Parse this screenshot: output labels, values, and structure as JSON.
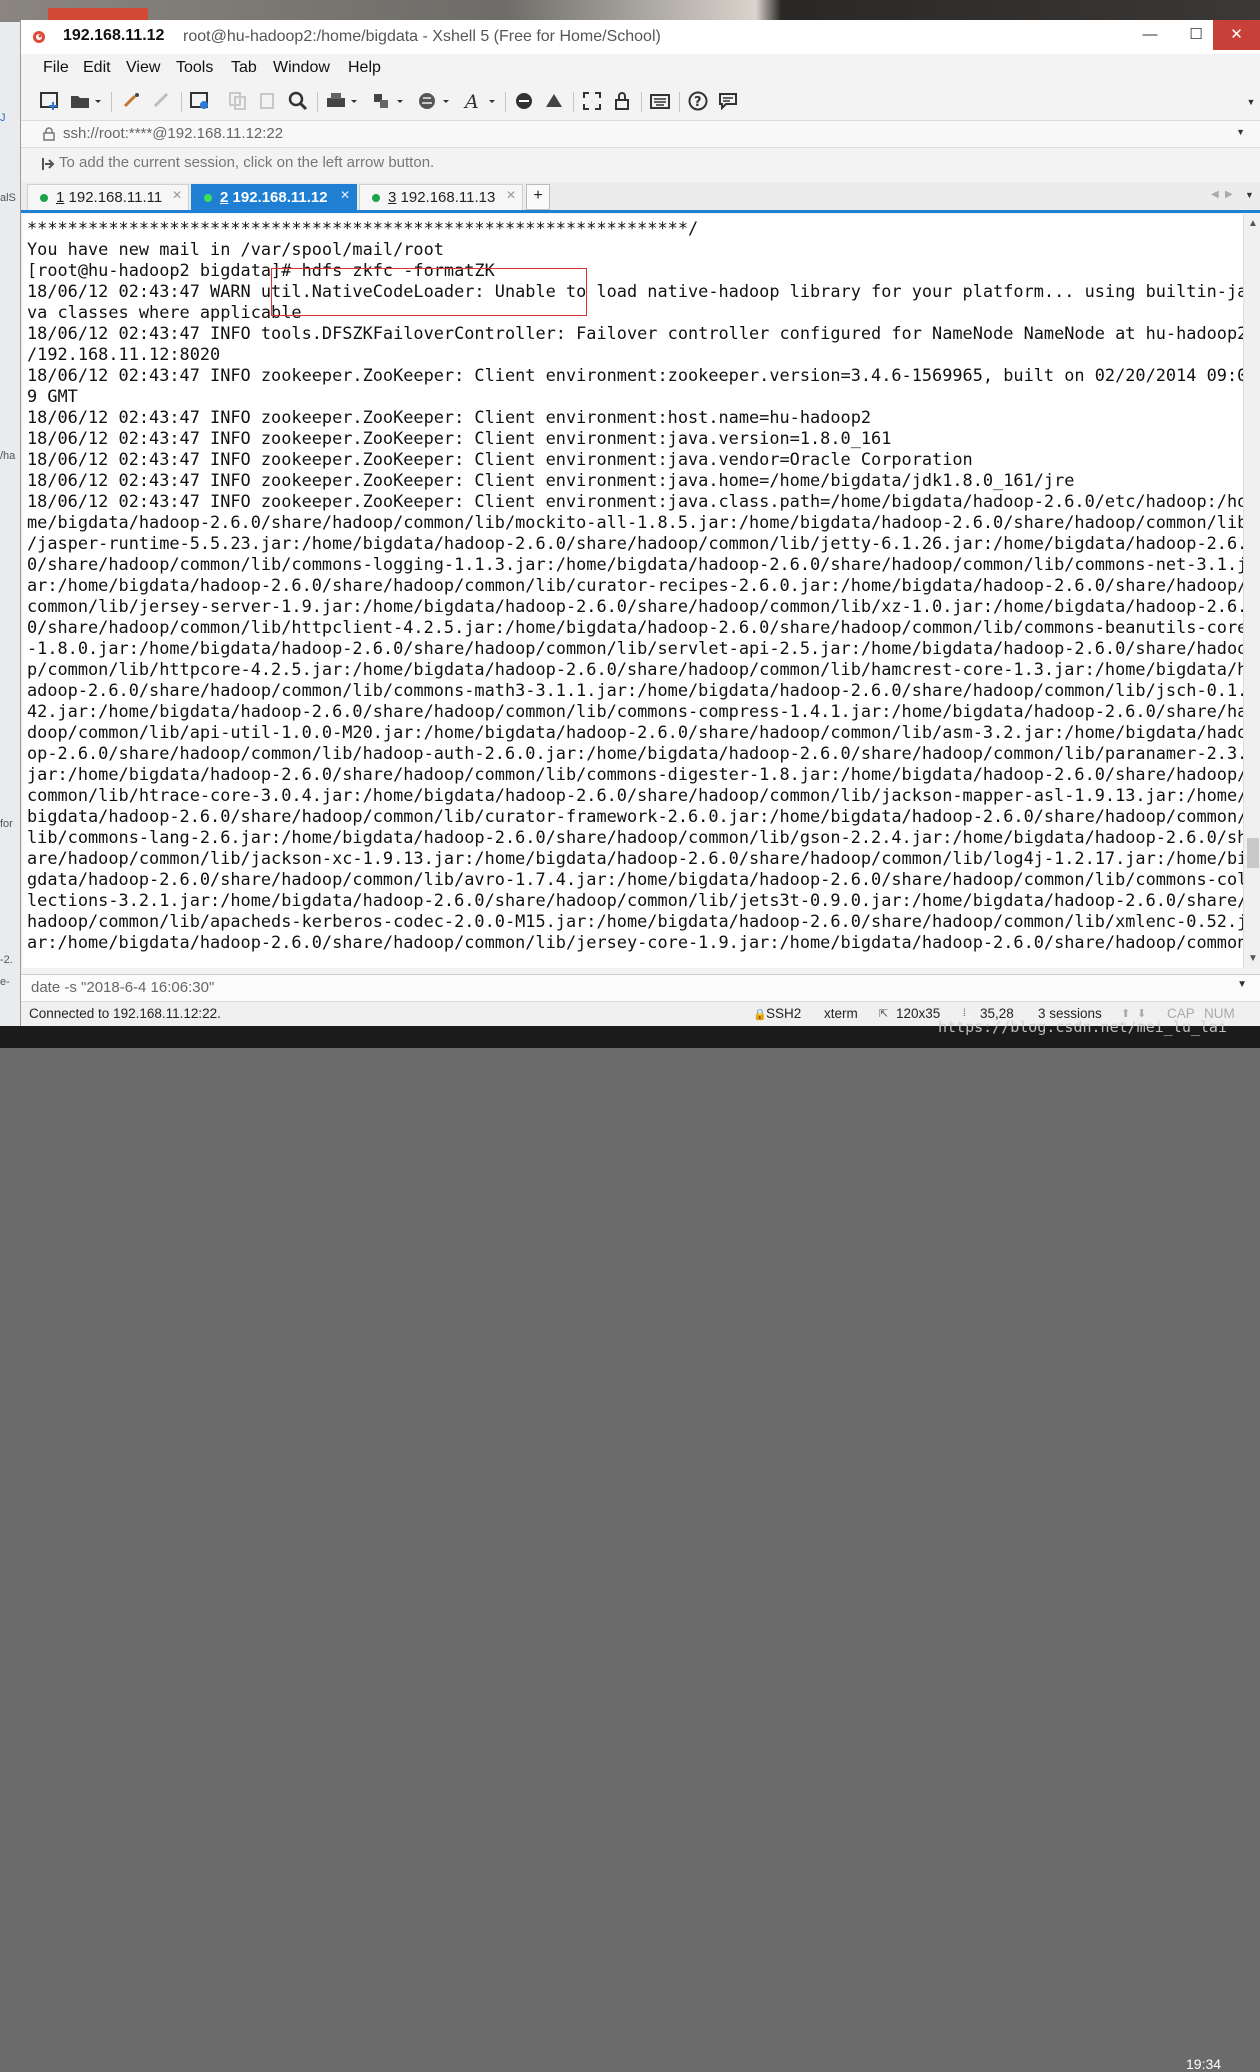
{
  "window": {
    "title_ip": "192.168.11.12",
    "title_rest": "root@hu-hadoop2:/home/bigdata - Xshell 5 (Free for Home/School)",
    "controls": {
      "minimize": "—",
      "maximize": "☐",
      "close": "✕"
    }
  },
  "menu": [
    "File",
    "Edit",
    "View",
    "Tools",
    "Tab",
    "Window",
    "Help"
  ],
  "address": {
    "text": "ssh://root:****@192.168.11.12:22"
  },
  "hint": {
    "text": "To add the current session, click on the left arrow button."
  },
  "tabs": [
    {
      "num": "1",
      "label": " 192.168.11.11",
      "active": false
    },
    {
      "num": "2",
      "label": " 192.168.11.12",
      "active": true
    },
    {
      "num": "3",
      "label": " 192.168.11.13",
      "active": false
    }
  ],
  "tab_add": "+",
  "terminal": {
    "lines": [
      "*****************************************************************/",
      "You have new mail in /var/spool/mail/root",
      "[root@hu-hadoop2 bigdata]# hdfs zkfc -formatZK",
      "18/06/12 02:43:47 WARN util.NativeCodeLoader: Unable to load native-hadoop library for your platform... using builtin-ja",
      "va classes where applicable",
      "18/06/12 02:43:47 INFO tools.DFSZKFailoverController: Failover controller configured for NameNode NameNode at hu-hadoop2",
      "/192.168.11.12:8020",
      "18/06/12 02:43:47 INFO zookeeper.ZooKeeper: Client environment:zookeeper.version=3.4.6-1569965, built on 02/20/2014 09:0",
      "9 GMT",
      "18/06/12 02:43:47 INFO zookeeper.ZooKeeper: Client environment:host.name=hu-hadoop2",
      "18/06/12 02:43:47 INFO zookeeper.ZooKeeper: Client environment:java.version=1.8.0_161",
      "18/06/12 02:43:47 INFO zookeeper.ZooKeeper: Client environment:java.vendor=Oracle Corporation",
      "18/06/12 02:43:47 INFO zookeeper.ZooKeeper: Client environment:java.home=/home/bigdata/jdk1.8.0_161/jre",
      "18/06/12 02:43:47 INFO zookeeper.ZooKeeper: Client environment:java.class.path=/home/bigdata/hadoop-2.6.0/etc/hadoop:/ho",
      "me/bigdata/hadoop-2.6.0/share/hadoop/common/lib/mockito-all-1.8.5.jar:/home/bigdata/hadoop-2.6.0/share/hadoop/common/lib",
      "/jasper-runtime-5.5.23.jar:/home/bigdata/hadoop-2.6.0/share/hadoop/common/lib/jetty-6.1.26.jar:/home/bigdata/hadoop-2.6.",
      "0/share/hadoop/common/lib/commons-logging-1.1.3.jar:/home/bigdata/hadoop-2.6.0/share/hadoop/common/lib/commons-net-3.1.j",
      "ar:/home/bigdata/hadoop-2.6.0/share/hadoop/common/lib/curator-recipes-2.6.0.jar:/home/bigdata/hadoop-2.6.0/share/hadoop/",
      "common/lib/jersey-server-1.9.jar:/home/bigdata/hadoop-2.6.0/share/hadoop/common/lib/xz-1.0.jar:/home/bigdata/hadoop-2.6.",
      "0/share/hadoop/common/lib/httpclient-4.2.5.jar:/home/bigdata/hadoop-2.6.0/share/hadoop/common/lib/commons-beanutils-core",
      "-1.8.0.jar:/home/bigdata/hadoop-2.6.0/share/hadoop/common/lib/servlet-api-2.5.jar:/home/bigdata/hadoop-2.6.0/share/hadoo",
      "p/common/lib/httpcore-4.2.5.jar:/home/bigdata/hadoop-2.6.0/share/hadoop/common/lib/hamcrest-core-1.3.jar:/home/bigdata/h",
      "adoop-2.6.0/share/hadoop/common/lib/commons-math3-3.1.1.jar:/home/bigdata/hadoop-2.6.0/share/hadoop/common/lib/jsch-0.1.",
      "42.jar:/home/bigdata/hadoop-2.6.0/share/hadoop/common/lib/commons-compress-1.4.1.jar:/home/bigdata/hadoop-2.6.0/share/ha",
      "doop/common/lib/api-util-1.0.0-M20.jar:/home/bigdata/hadoop-2.6.0/share/hadoop/common/lib/asm-3.2.jar:/home/bigdata/hado",
      "op-2.6.0/share/hadoop/common/lib/hadoop-auth-2.6.0.jar:/home/bigdata/hadoop-2.6.0/share/hadoop/common/lib/paranamer-2.3.",
      "jar:/home/bigdata/hadoop-2.6.0/share/hadoop/common/lib/commons-digester-1.8.jar:/home/bigdata/hadoop-2.6.0/share/hadoop/",
      "common/lib/htrace-core-3.0.4.jar:/home/bigdata/hadoop-2.6.0/share/hadoop/common/lib/jackson-mapper-asl-1.9.13.jar:/home/",
      "bigdata/hadoop-2.6.0/share/hadoop/common/lib/curator-framework-2.6.0.jar:/home/bigdata/hadoop-2.6.0/share/hadoop/common/",
      "lib/commons-lang-2.6.jar:/home/bigdata/hadoop-2.6.0/share/hadoop/common/lib/gson-2.2.4.jar:/home/bigdata/hadoop-2.6.0/sh",
      "are/hadoop/common/lib/jackson-xc-1.9.13.jar:/home/bigdata/hadoop-2.6.0/share/hadoop/common/lib/log4j-1.2.17.jar:/home/bi",
      "gdata/hadoop-2.6.0/share/hadoop/common/lib/avro-1.7.4.jar:/home/bigdata/hadoop-2.6.0/share/hadoop/common/lib/commons-col",
      "lections-3.2.1.jar:/home/bigdata/hadoop-2.6.0/share/hadoop/common/lib/jets3t-0.9.0.jar:/home/bigdata/hadoop-2.6.0/share/",
      "hadoop/common/lib/apacheds-kerberos-codec-2.0.0-M15.jar:/home/bigdata/hadoop-2.6.0/share/hadoop/common/lib/xmlenc-0.52.j",
      "ar:/home/bigdata/hadoop-2.6.0/share/hadoop/common/lib/jersey-core-1.9.jar:/home/bigdata/hadoop-2.6.0/share/hadoop/common"
    ]
  },
  "compose": {
    "text": "date -s \"2018-6-4 16:06:30\""
  },
  "status": {
    "connected": "Connected to 192.168.11.12:22.",
    "protocol": "SSH2",
    "term": "xterm",
    "size": "120x35",
    "cursor": "35,28",
    "sessions": "3 sessions",
    "cap": "CAP",
    "num": "NUM"
  },
  "left_fragments": [
    "J",
    "alS",
    "/ha",
    "for",
    "-2.",
    "e-"
  ],
  "watermark": "https://blog.csdn.net/mei_lu_lai",
  "clock": "19:34",
  "colors": {
    "accent": "#1f7fd2",
    "close": "#c94038",
    "highlight_box": "#dd3333"
  }
}
